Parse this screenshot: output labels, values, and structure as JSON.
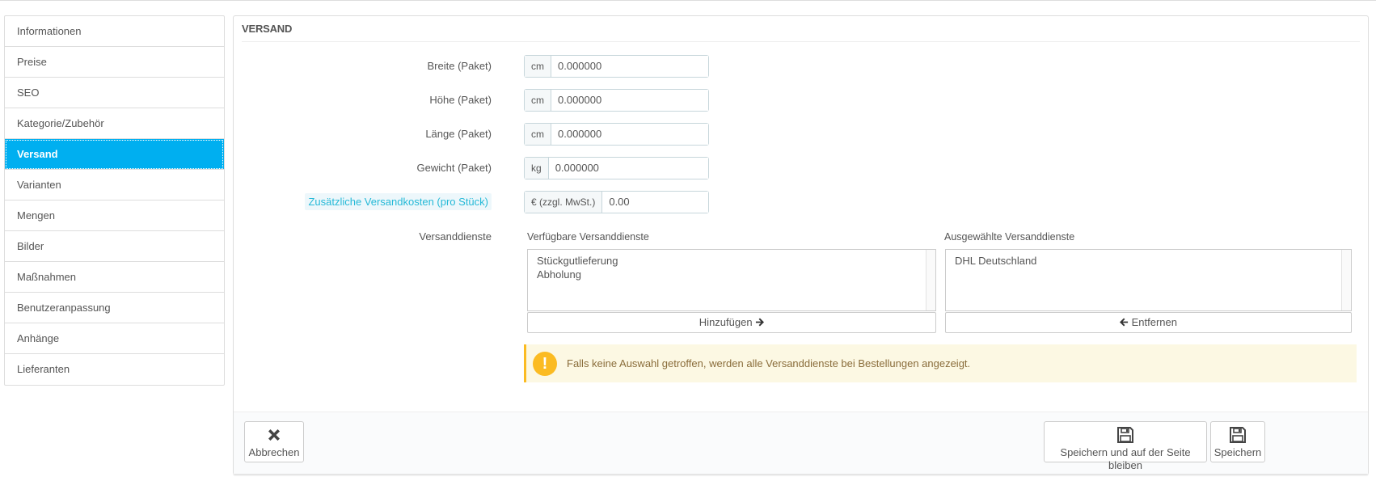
{
  "sidebar": {
    "items": [
      {
        "label": "Informationen"
      },
      {
        "label": "Preise"
      },
      {
        "label": "SEO"
      },
      {
        "label": "Kategorie/Zubehör"
      },
      {
        "label": "Versand"
      },
      {
        "label": "Varianten"
      },
      {
        "label": "Mengen"
      },
      {
        "label": "Bilder"
      },
      {
        "label": "Maßnahmen"
      },
      {
        "label": "Benutzeranpassung"
      },
      {
        "label": "Anhänge"
      },
      {
        "label": "Lieferanten"
      }
    ],
    "active": "Versand"
  },
  "panel": {
    "title": "VERSAND"
  },
  "fields": {
    "width": {
      "label": "Breite (Paket)",
      "unit": "cm",
      "value": "0.000000"
    },
    "height": {
      "label": "Höhe (Paket)",
      "unit": "cm",
      "value": "0.000000"
    },
    "depth": {
      "label": "Länge (Paket)",
      "unit": "cm",
      "value": "0.000000"
    },
    "weight": {
      "label": "Gewicht (Paket)",
      "unit": "kg",
      "value": "0.000000"
    },
    "extra_cost": {
      "label": "Zusätzliche Versandkosten (pro Stück)",
      "unit": "€ (zzgl. MwSt.)",
      "value": "0.00"
    }
  },
  "carriers": {
    "label": "Versanddienste",
    "available_title": "Verfügbare Versanddienste",
    "available": [
      "Stückgutlieferung",
      "Abholung"
    ],
    "selected_title": "Ausgewählte Versanddienste",
    "selected": [
      "DHL Deutschland"
    ],
    "add_label": "Hinzufügen",
    "remove_label": "Entfernen"
  },
  "alert": {
    "icon": "!",
    "text": "Falls keine Auswahl getroffen, werden alle Versanddienste bei Bestellungen angezeigt."
  },
  "footer": {
    "cancel_label": "Abbrechen",
    "save_stay_label": "Speichern und auf der Seite bleiben",
    "save_label": "Speichern"
  },
  "colors": {
    "active": "#00aff0",
    "hint": "#25b9d7",
    "warning": "#fbbb22"
  }
}
